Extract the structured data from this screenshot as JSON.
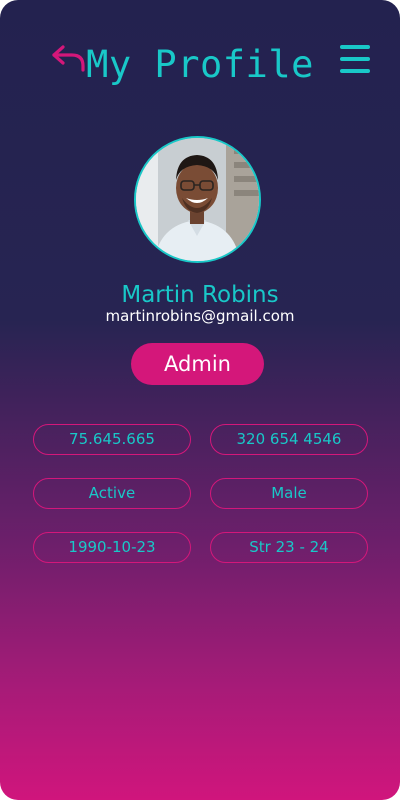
{
  "header": {
    "title": "My Profile",
    "back_icon": "back-arrow-icon",
    "menu_icon": "hamburger-menu-icon"
  },
  "profile": {
    "name": "Martin Robins",
    "email": "martinrobins@gmail.com",
    "role": "Admin"
  },
  "fields": [
    {
      "value": "75.645.665"
    },
    {
      "value": "320 654 4546"
    },
    {
      "value": "Active"
    },
    {
      "value": "Male"
    },
    {
      "value": "1990-10-23"
    },
    {
      "value": "Str 23 - 24"
    }
  ],
  "colors": {
    "accent_cyan": "#19c8c8",
    "accent_pink": "#d4177a",
    "background_top": "#23224f",
    "background_bottom": "#d0157c"
  }
}
